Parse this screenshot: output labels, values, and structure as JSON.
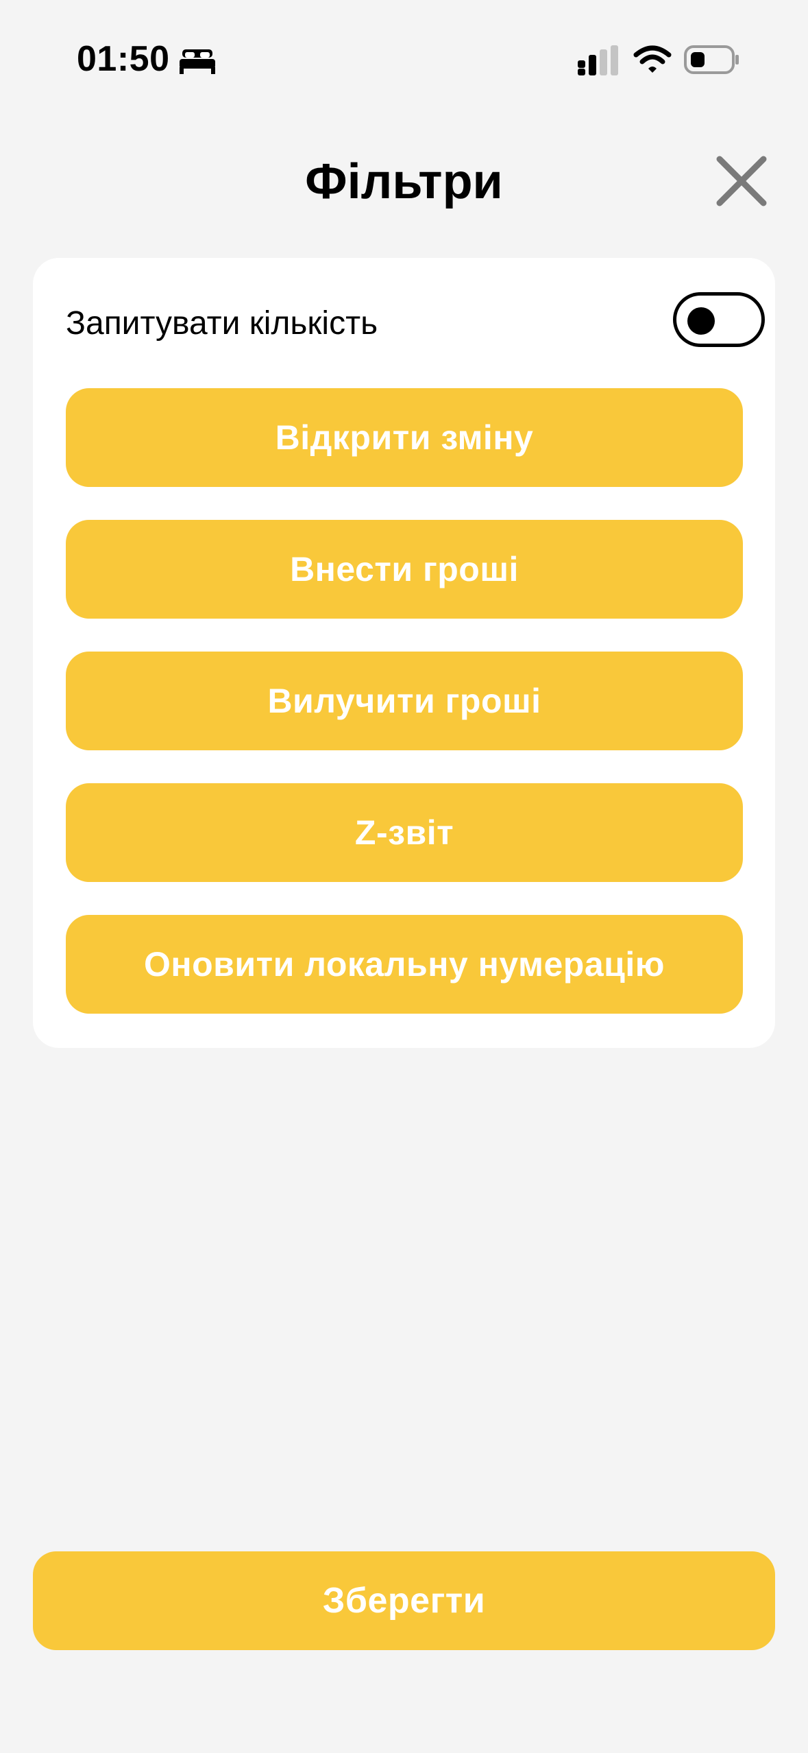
{
  "status_bar": {
    "time": "01:50",
    "icons": [
      "sleep-icon",
      "cellular-signal-icon",
      "wifi-icon",
      "battery-icon"
    ]
  },
  "header": {
    "title": "Фільтри",
    "close_icon": "close-icon"
  },
  "filters": {
    "toggle": {
      "label": "Запитувати кількість",
      "enabled": false
    },
    "buttons": [
      {
        "label": "Відкрити зміну"
      },
      {
        "label": "Внести гроші"
      },
      {
        "label": "Вилучити гроші"
      },
      {
        "label": "Z-звіт"
      },
      {
        "label": "Оновити локальну нумерацію"
      }
    ]
  },
  "footer": {
    "save_label": "Зберегти"
  },
  "colors": {
    "background": "#f4f4f4",
    "card": "#ffffff",
    "accent": "#f9c83a",
    "button_text": "#ffffff",
    "close_icon": "#7a7a7a"
  }
}
